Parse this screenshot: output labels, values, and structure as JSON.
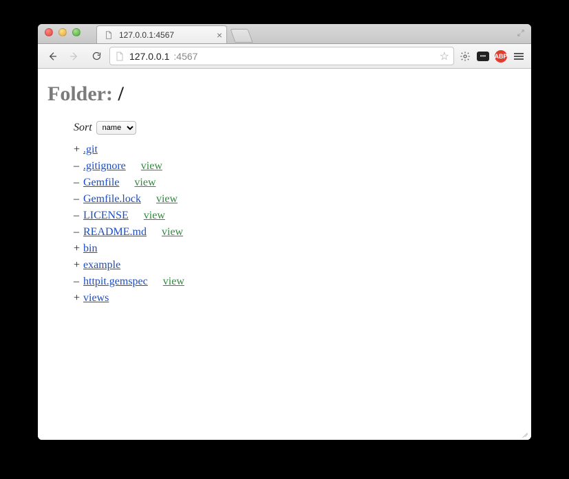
{
  "tab": {
    "title": "127.0.0.1:4567"
  },
  "address": {
    "host": "127.0.0.1",
    "port": ":4567"
  },
  "page": {
    "heading_prefix": "Folder: ",
    "heading_path": "/",
    "sort_label": "Sort",
    "sort_value": "name",
    "view_label": "view",
    "items": [
      {
        "sym": "+",
        "name": ".git",
        "type": "dir"
      },
      {
        "sym": "–",
        "name": ".gitignore",
        "type": "file"
      },
      {
        "sym": "–",
        "name": "Gemfile",
        "type": "file"
      },
      {
        "sym": "–",
        "name": "Gemfile.lock",
        "type": "file"
      },
      {
        "sym": "–",
        "name": "LICENSE",
        "type": "file"
      },
      {
        "sym": "–",
        "name": "README.md",
        "type": "file"
      },
      {
        "sym": "+",
        "name": "bin",
        "type": "dir"
      },
      {
        "sym": "+",
        "name": "example",
        "type": "dir"
      },
      {
        "sym": "–",
        "name": "httpit.gemspec",
        "type": "file"
      },
      {
        "sym": "+",
        "name": "views",
        "type": "dir"
      }
    ]
  },
  "abp_label": "ABP"
}
